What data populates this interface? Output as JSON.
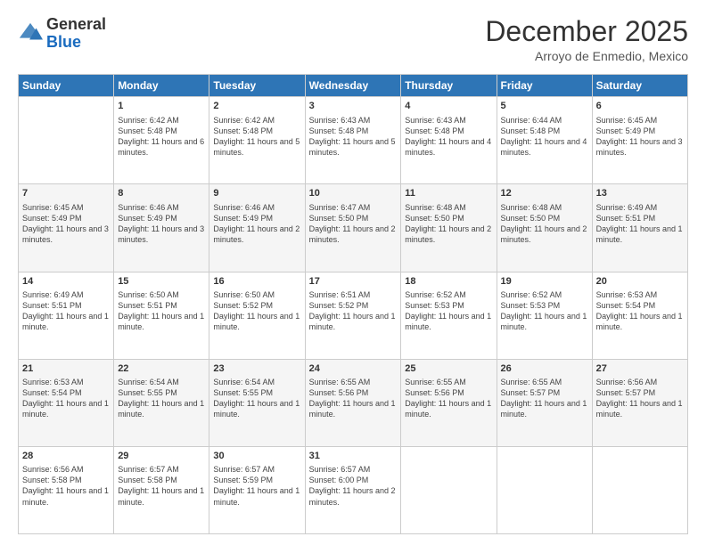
{
  "logo": {
    "general": "General",
    "blue": "Blue"
  },
  "header": {
    "month": "December 2025",
    "location": "Arroyo de Enmedio, Mexico"
  },
  "days": [
    "Sunday",
    "Monday",
    "Tuesday",
    "Wednesday",
    "Thursday",
    "Friday",
    "Saturday"
  ],
  "weeks": [
    [
      {
        "num": "",
        "sunrise": "",
        "sunset": "",
        "daylight": ""
      },
      {
        "num": "1",
        "sunrise": "Sunrise: 6:42 AM",
        "sunset": "Sunset: 5:48 PM",
        "daylight": "Daylight: 11 hours and 6 minutes."
      },
      {
        "num": "2",
        "sunrise": "Sunrise: 6:42 AM",
        "sunset": "Sunset: 5:48 PM",
        "daylight": "Daylight: 11 hours and 5 minutes."
      },
      {
        "num": "3",
        "sunrise": "Sunrise: 6:43 AM",
        "sunset": "Sunset: 5:48 PM",
        "daylight": "Daylight: 11 hours and 5 minutes."
      },
      {
        "num": "4",
        "sunrise": "Sunrise: 6:43 AM",
        "sunset": "Sunset: 5:48 PM",
        "daylight": "Daylight: 11 hours and 4 minutes."
      },
      {
        "num": "5",
        "sunrise": "Sunrise: 6:44 AM",
        "sunset": "Sunset: 5:48 PM",
        "daylight": "Daylight: 11 hours and 4 minutes."
      },
      {
        "num": "6",
        "sunrise": "Sunrise: 6:45 AM",
        "sunset": "Sunset: 5:49 PM",
        "daylight": "Daylight: 11 hours and 3 minutes."
      }
    ],
    [
      {
        "num": "7",
        "sunrise": "Sunrise: 6:45 AM",
        "sunset": "Sunset: 5:49 PM",
        "daylight": "Daylight: 11 hours and 3 minutes."
      },
      {
        "num": "8",
        "sunrise": "Sunrise: 6:46 AM",
        "sunset": "Sunset: 5:49 PM",
        "daylight": "Daylight: 11 hours and 3 minutes."
      },
      {
        "num": "9",
        "sunrise": "Sunrise: 6:46 AM",
        "sunset": "Sunset: 5:49 PM",
        "daylight": "Daylight: 11 hours and 2 minutes."
      },
      {
        "num": "10",
        "sunrise": "Sunrise: 6:47 AM",
        "sunset": "Sunset: 5:50 PM",
        "daylight": "Daylight: 11 hours and 2 minutes."
      },
      {
        "num": "11",
        "sunrise": "Sunrise: 6:48 AM",
        "sunset": "Sunset: 5:50 PM",
        "daylight": "Daylight: 11 hours and 2 minutes."
      },
      {
        "num": "12",
        "sunrise": "Sunrise: 6:48 AM",
        "sunset": "Sunset: 5:50 PM",
        "daylight": "Daylight: 11 hours and 2 minutes."
      },
      {
        "num": "13",
        "sunrise": "Sunrise: 6:49 AM",
        "sunset": "Sunset: 5:51 PM",
        "daylight": "Daylight: 11 hours and 1 minute."
      }
    ],
    [
      {
        "num": "14",
        "sunrise": "Sunrise: 6:49 AM",
        "sunset": "Sunset: 5:51 PM",
        "daylight": "Daylight: 11 hours and 1 minute."
      },
      {
        "num": "15",
        "sunrise": "Sunrise: 6:50 AM",
        "sunset": "Sunset: 5:51 PM",
        "daylight": "Daylight: 11 hours and 1 minute."
      },
      {
        "num": "16",
        "sunrise": "Sunrise: 6:50 AM",
        "sunset": "Sunset: 5:52 PM",
        "daylight": "Daylight: 11 hours and 1 minute."
      },
      {
        "num": "17",
        "sunrise": "Sunrise: 6:51 AM",
        "sunset": "Sunset: 5:52 PM",
        "daylight": "Daylight: 11 hours and 1 minute."
      },
      {
        "num": "18",
        "sunrise": "Sunrise: 6:52 AM",
        "sunset": "Sunset: 5:53 PM",
        "daylight": "Daylight: 11 hours and 1 minute."
      },
      {
        "num": "19",
        "sunrise": "Sunrise: 6:52 AM",
        "sunset": "Sunset: 5:53 PM",
        "daylight": "Daylight: 11 hours and 1 minute."
      },
      {
        "num": "20",
        "sunrise": "Sunrise: 6:53 AM",
        "sunset": "Sunset: 5:54 PM",
        "daylight": "Daylight: 11 hours and 1 minute."
      }
    ],
    [
      {
        "num": "21",
        "sunrise": "Sunrise: 6:53 AM",
        "sunset": "Sunset: 5:54 PM",
        "daylight": "Daylight: 11 hours and 1 minute."
      },
      {
        "num": "22",
        "sunrise": "Sunrise: 6:54 AM",
        "sunset": "Sunset: 5:55 PM",
        "daylight": "Daylight: 11 hours and 1 minute."
      },
      {
        "num": "23",
        "sunrise": "Sunrise: 6:54 AM",
        "sunset": "Sunset: 5:55 PM",
        "daylight": "Daylight: 11 hours and 1 minute."
      },
      {
        "num": "24",
        "sunrise": "Sunrise: 6:55 AM",
        "sunset": "Sunset: 5:56 PM",
        "daylight": "Daylight: 11 hours and 1 minute."
      },
      {
        "num": "25",
        "sunrise": "Sunrise: 6:55 AM",
        "sunset": "Sunset: 5:56 PM",
        "daylight": "Daylight: 11 hours and 1 minute."
      },
      {
        "num": "26",
        "sunrise": "Sunrise: 6:55 AM",
        "sunset": "Sunset: 5:57 PM",
        "daylight": "Daylight: 11 hours and 1 minute."
      },
      {
        "num": "27",
        "sunrise": "Sunrise: 6:56 AM",
        "sunset": "Sunset: 5:57 PM",
        "daylight": "Daylight: 11 hours and 1 minute."
      }
    ],
    [
      {
        "num": "28",
        "sunrise": "Sunrise: 6:56 AM",
        "sunset": "Sunset: 5:58 PM",
        "daylight": "Daylight: 11 hours and 1 minute."
      },
      {
        "num": "29",
        "sunrise": "Sunrise: 6:57 AM",
        "sunset": "Sunset: 5:58 PM",
        "daylight": "Daylight: 11 hours and 1 minute."
      },
      {
        "num": "30",
        "sunrise": "Sunrise: 6:57 AM",
        "sunset": "Sunset: 5:59 PM",
        "daylight": "Daylight: 11 hours and 1 minute."
      },
      {
        "num": "31",
        "sunrise": "Sunrise: 6:57 AM",
        "sunset": "Sunset: 6:00 PM",
        "daylight": "Daylight: 11 hours and 2 minutes."
      },
      {
        "num": "",
        "sunrise": "",
        "sunset": "",
        "daylight": ""
      },
      {
        "num": "",
        "sunrise": "",
        "sunset": "",
        "daylight": ""
      },
      {
        "num": "",
        "sunrise": "",
        "sunset": "",
        "daylight": ""
      }
    ]
  ]
}
